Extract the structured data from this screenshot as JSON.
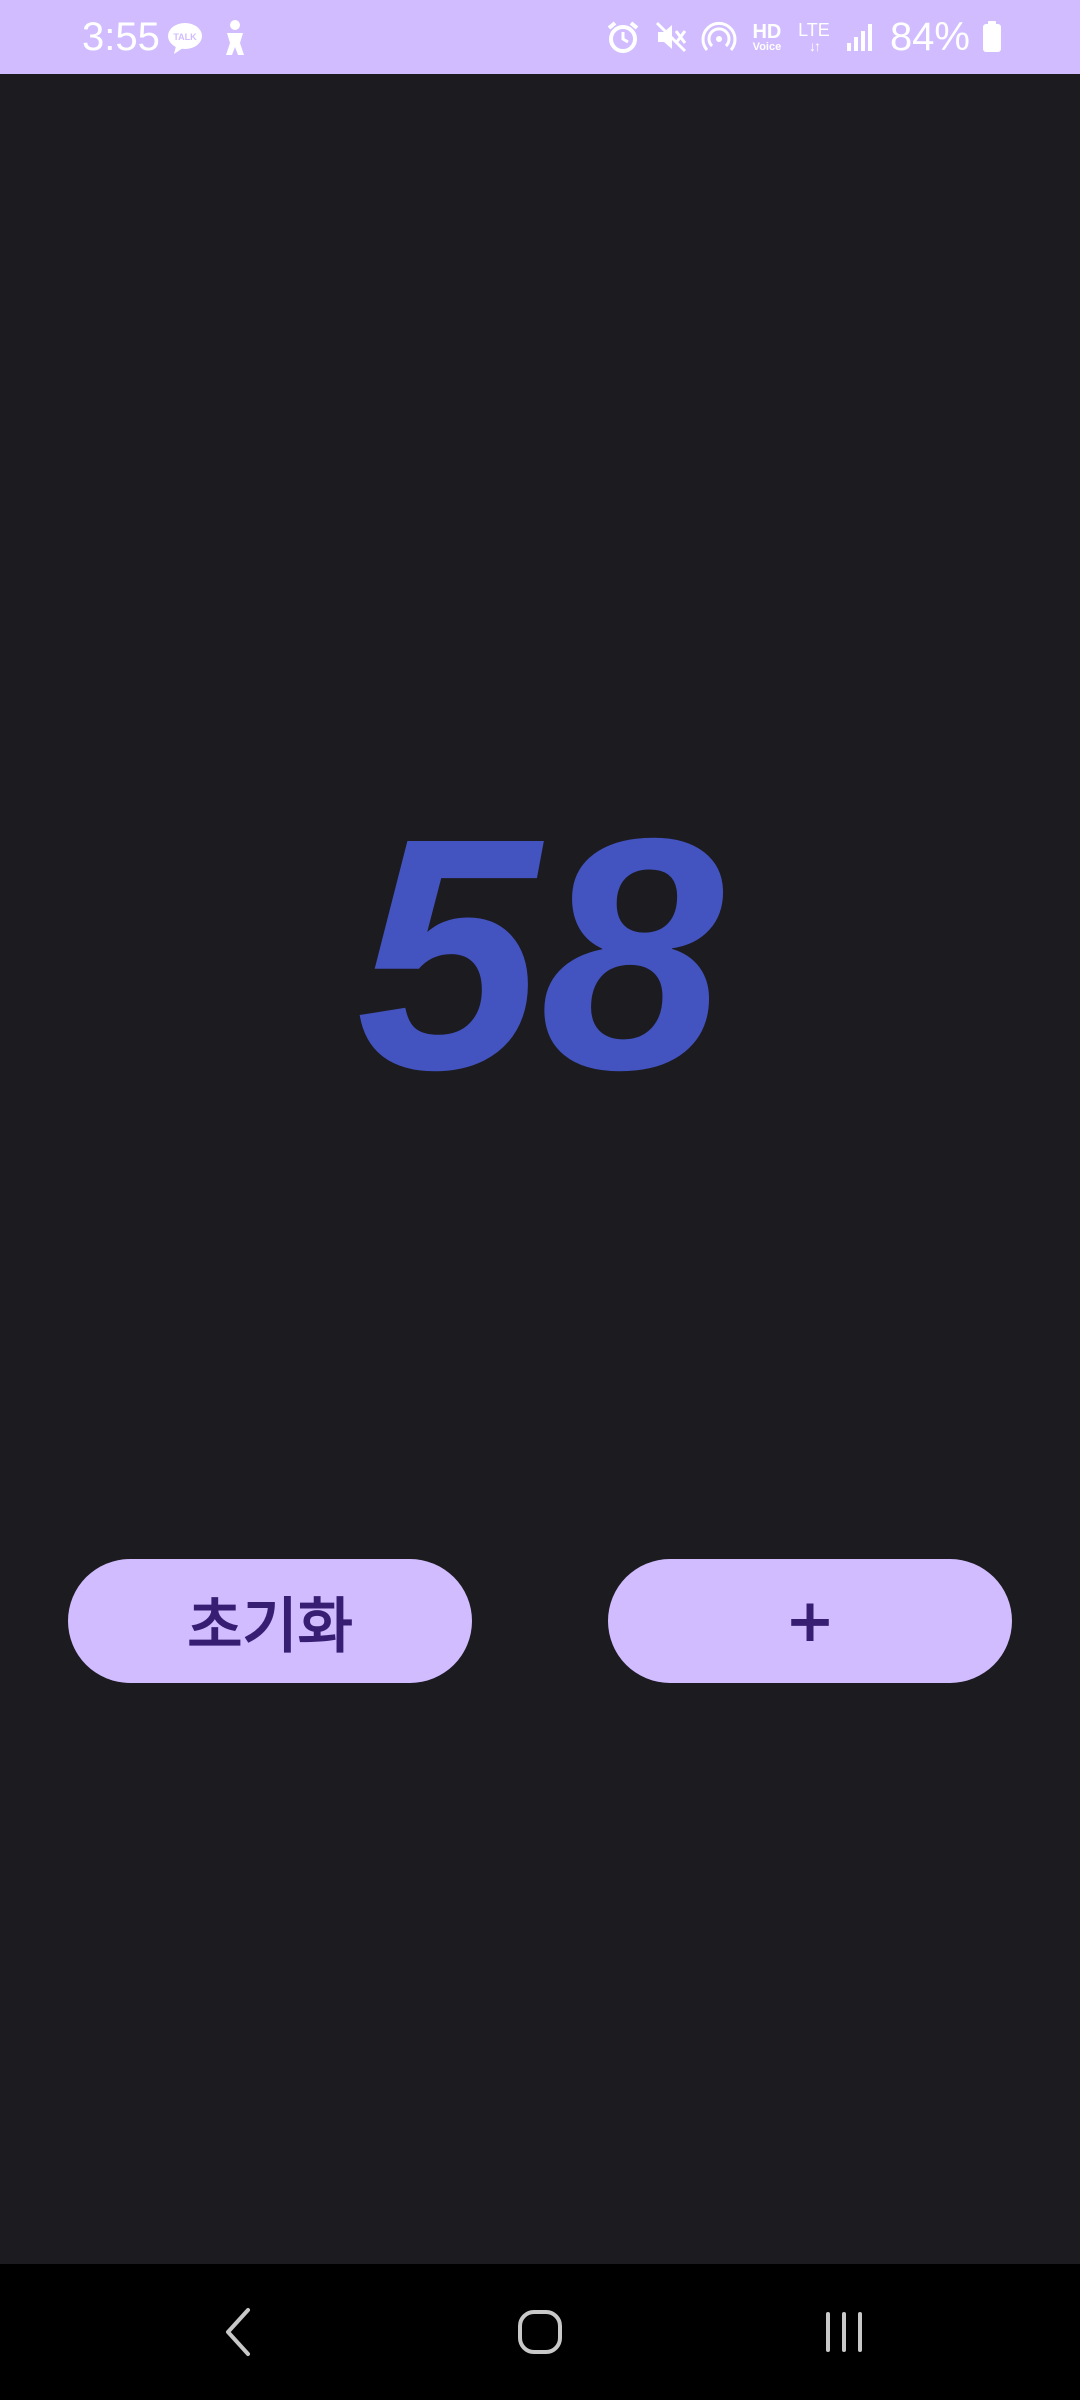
{
  "status_bar": {
    "time": "3:55",
    "battery_percent": "84%",
    "left_icons": [
      "kakaotalk-icon",
      "accessibility-icon"
    ],
    "right_icons": [
      "alarm-icon",
      "mute-icon",
      "hotspot-icon",
      "hd-voice-icon",
      "lte-icon",
      "signal-icon",
      "battery-icon"
    ],
    "hd_label": "HD",
    "voice_label": "Voice",
    "lte_label": "LTE",
    "talk_label": "TALK"
  },
  "counter": {
    "value": "58",
    "color": "#4353bf"
  },
  "buttons": {
    "reset_label": "초기화",
    "increment_label": "+"
  },
  "colors": {
    "accent": "#d0bcff",
    "button_text": "#371e73",
    "background": "#1c1b1f",
    "nav_background": "#000000"
  },
  "nav_bar": {
    "icons": [
      "back-icon",
      "home-icon",
      "recents-icon"
    ]
  }
}
